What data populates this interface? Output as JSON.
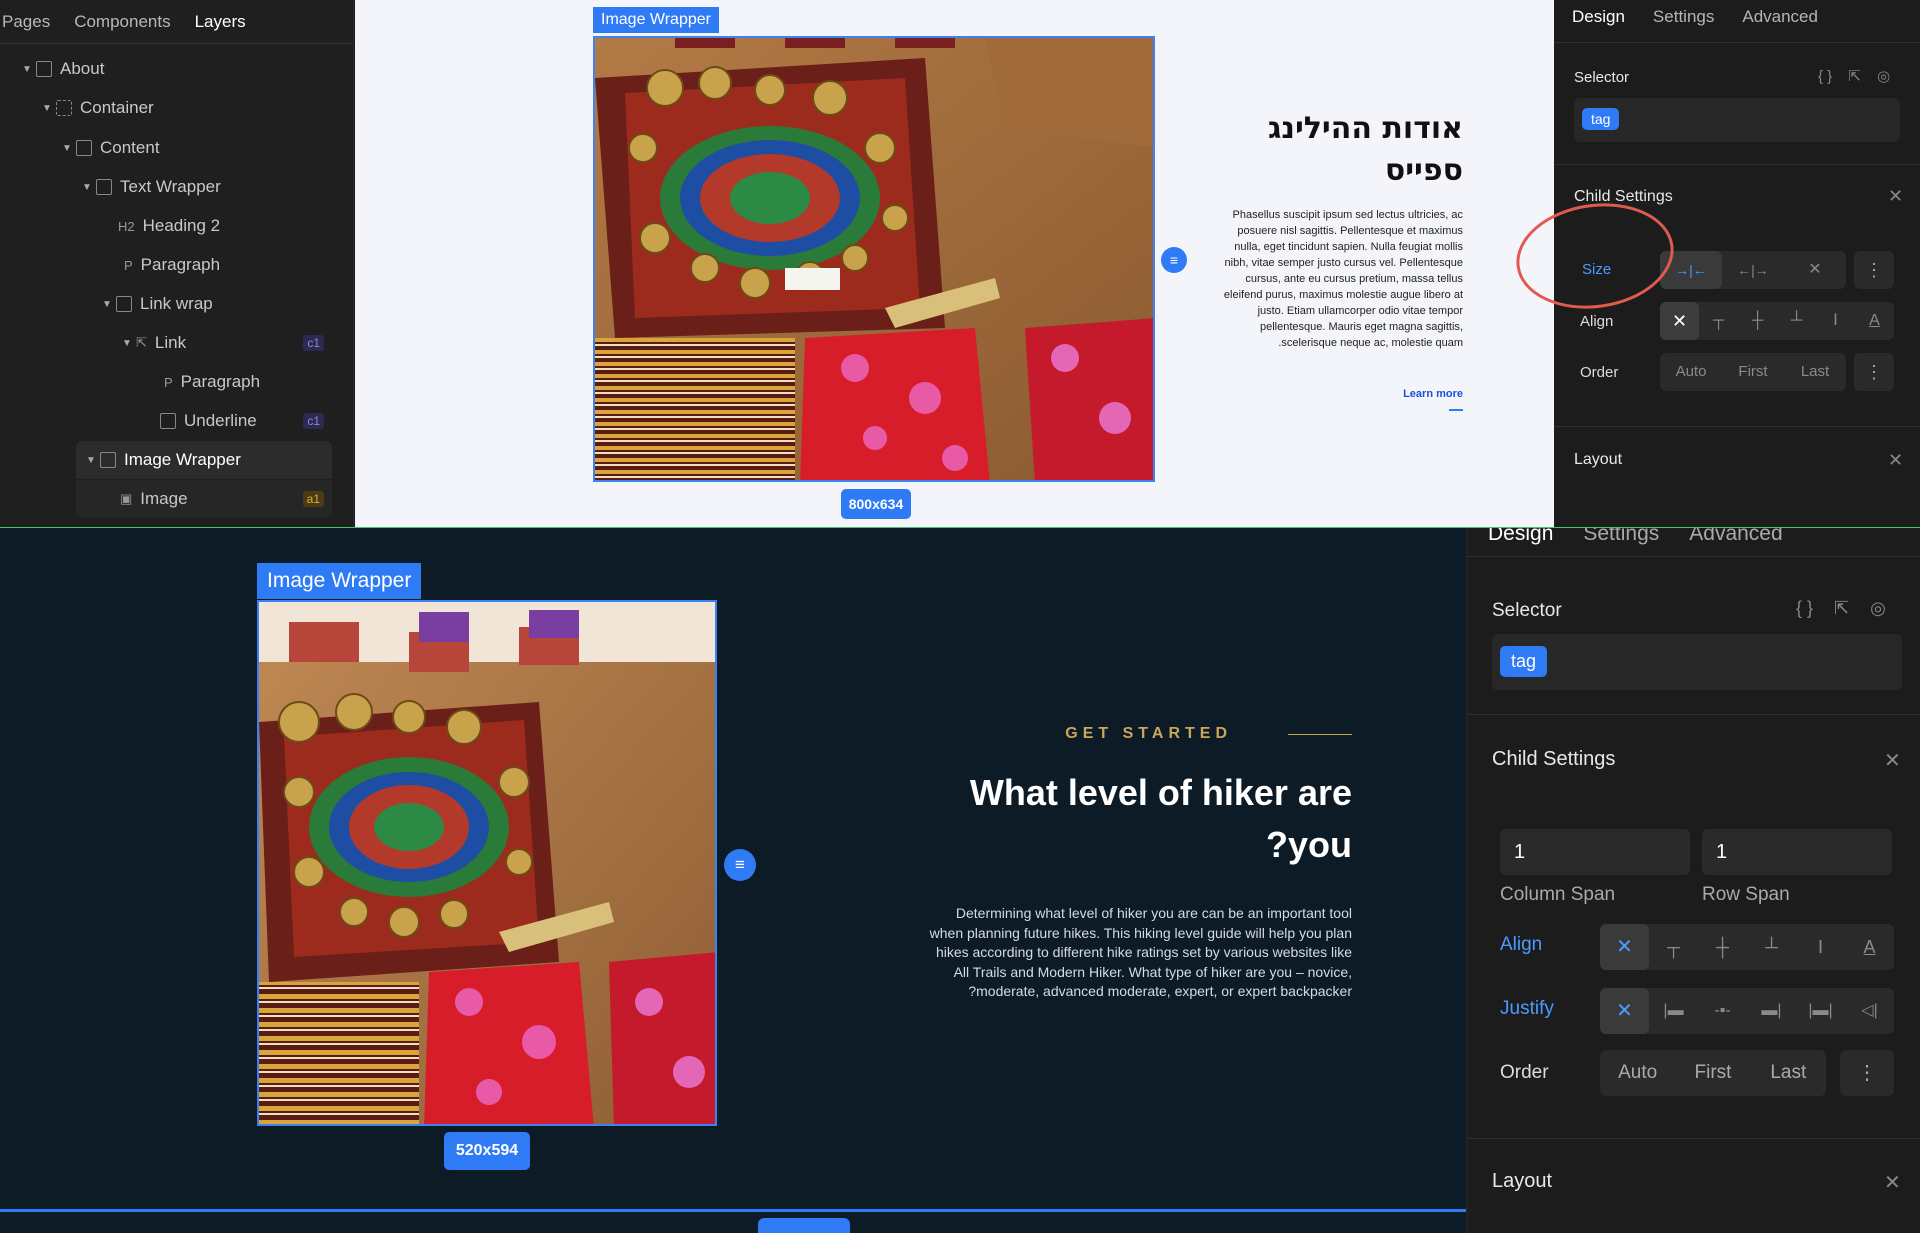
{
  "top": {
    "left_tabs": [
      "Pages",
      "Components",
      "Layers"
    ],
    "layers": [
      {
        "label": "About",
        "badge": ""
      },
      {
        "label": "Container",
        "badge": ""
      },
      {
        "label": "Content",
        "badge": ""
      },
      {
        "label": "Text Wrapper",
        "badge": ""
      },
      {
        "label": "Heading 2",
        "prefix": "H2",
        "badge": ""
      },
      {
        "label": "Paragraph",
        "prefix": "P",
        "badge": ""
      },
      {
        "label": "Link wrap",
        "badge": ""
      },
      {
        "label": "Link",
        "badge": "c1"
      },
      {
        "label": "Paragraph",
        "prefix": "P",
        "badge": ""
      },
      {
        "label": "Underline",
        "badge": "c1"
      },
      {
        "label": "Image Wrapper",
        "badge": ""
      },
      {
        "label": "Image",
        "badge": "a1"
      }
    ],
    "canvas": {
      "wrapper_tag": "Image Wrapper",
      "dimensions": "800x634",
      "heading": "אודות ההילינג ספייס",
      "paragraph": "Phasellus suscipit ipsum sed lectus ultricies, ac posuere nisl sagittis. Pellentesque et maximus nulla, eget tincidunt sapien. Nulla feugiat mollis nibh, vitae semper justo cursus vel. Pellentesque cursus, ante eu cursus pretium, massa tellus eleifend purus, maximus molestie augue libero at justo. Etiam ullamcorper odio vitae tempor pellentesque. Mauris eget magna sagittis, .scelerisque neque ac, molestie quam",
      "link": "Learn more"
    },
    "right": {
      "tabs": [
        "Design",
        "Settings",
        "Advanced"
      ],
      "selector_label": "Selector",
      "tag_chip": "tag",
      "child_settings": "Child Settings",
      "size_label": "Size",
      "align_label": "Align",
      "order_label": "Order",
      "order_options": [
        "Auto",
        "First",
        "Last"
      ],
      "layout_label": "Layout"
    }
  },
  "bottom": {
    "canvas": {
      "wrapper_tag": "Image Wrapper",
      "dimensions": "520x594",
      "eyebrow": "GET STARTED",
      "heading_line1": "What level of  hiker are",
      "heading_line2": "?you",
      "paragraph_lines": [
        "Determining what level of hiker you are can be an important tool",
        "when planning future hikes. This hiking level guide will help you plan",
        "hikes according to different hike ratings set by various websites like",
        "All Trails and Modern Hiker. What type of hiker are you – novice,",
        "?moderate, advanced moderate, expert, or expert backpacker"
      ]
    },
    "right": {
      "tabs": [
        "Design",
        "Settings",
        "Advanced"
      ],
      "selector_label": "Selector",
      "tag_chip": "tag",
      "child_settings": "Child Settings",
      "column_span_value": "1",
      "row_span_value": "1",
      "column_span_label": "Column Span",
      "row_span_label": "Row Span",
      "align_label": "Align",
      "justify_label": "Justify",
      "order_label": "Order",
      "order_options": [
        "Auto",
        "First",
        "Last"
      ],
      "layout_label": "Layout"
    }
  },
  "colors": {
    "accent": "#2f7bf5",
    "annotation": "#e05a4f",
    "gold": "#c9a65a"
  }
}
